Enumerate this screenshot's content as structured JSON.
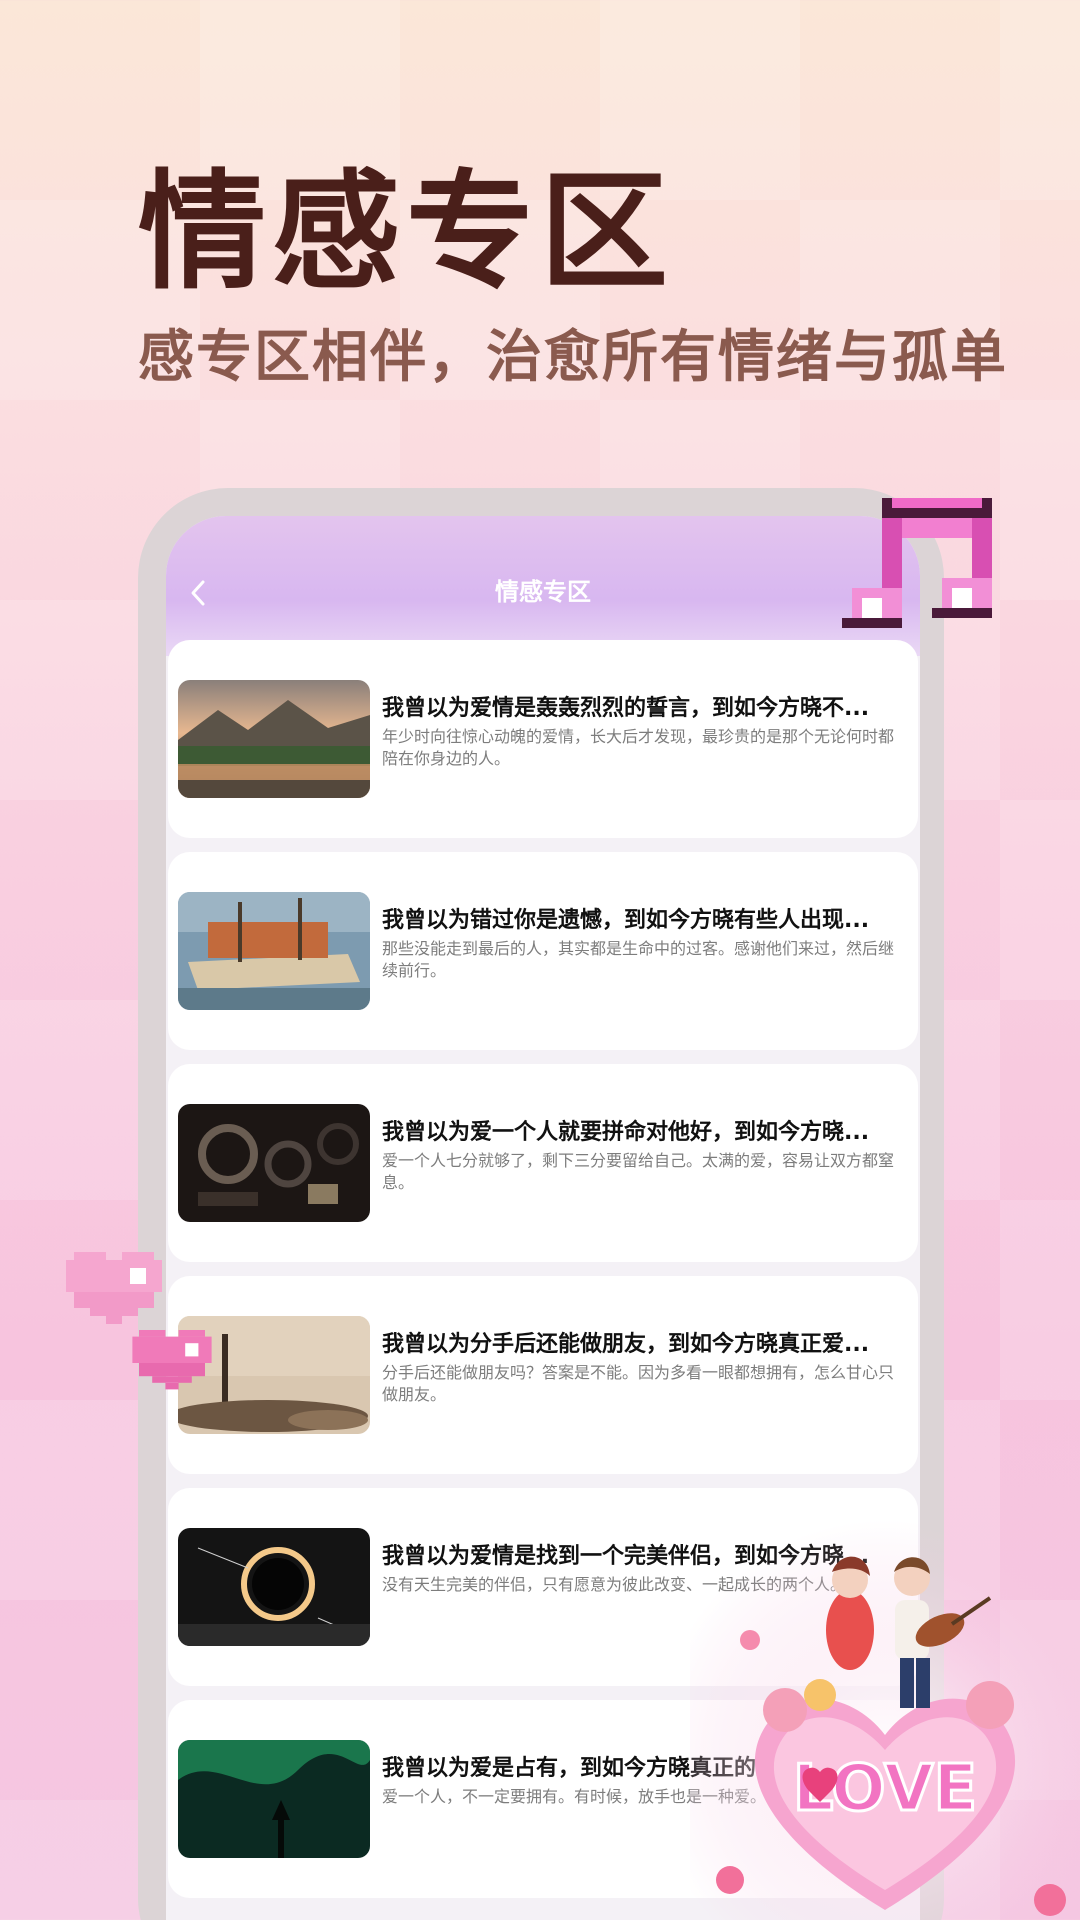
{
  "headline": "情感专区",
  "subline": "感专区相伴，治愈所有情绪与孤单",
  "app": {
    "nav_title": "情感专区",
    "back_icon": "chevron-left-icon"
  },
  "articles": [
    {
      "title": "我曾以为爱情是轰轰烈烈的誓言，到如今方晓不...",
      "desc": "年少时向往惊心动魄的爱情，长大后才发现，最珍贵的是那个无论何时都陪在你身边的人。",
      "thumb": "mountain-lake-sunset"
    },
    {
      "title": "我曾以为错过你是遗憾，到如今方晓有些人出现...",
      "desc": "那些没能走到最后的人，其实都是生命中的过客。感谢他们来过，然后继续前行。",
      "thumb": "boat-harbor"
    },
    {
      "title": "我曾以为爱一个人就要拼命对他好，到如今方晓...",
      "desc": "爱一个人七分就够了，剩下三分要留给自己。太满的爱，容易让双方都窒息。",
      "thumb": "machinery-dark"
    },
    {
      "title": "我曾以为分手后还能做朋友，到如今方晓真正爱...",
      "desc": "分手后还能做朋友吗？答案是不能。因为多看一眼都想拥有，怎么甘心只做朋友。",
      "thumb": "misty-shore-stones"
    },
    {
      "title": "我曾以为爱情是找到一个完美伴侣，到如今方晓...",
      "desc": "没有天生完美的伴侣，只有愿意为彼此改变、一起成长的两个人。",
      "thumb": "fire-ring-night"
    },
    {
      "title": "我曾以为爱是占有，到如今方晓真正的爱...",
      "desc": "爱一个人，不一定要拥有。有时候，放手也是一种爱。",
      "thumb": "aurora-green"
    }
  ],
  "decor": {
    "love_text": "LOVE"
  },
  "colors": {
    "headline": "#4a1f1a",
    "subline": "#8a5a4e",
    "accent_pink": "#e455b8"
  }
}
